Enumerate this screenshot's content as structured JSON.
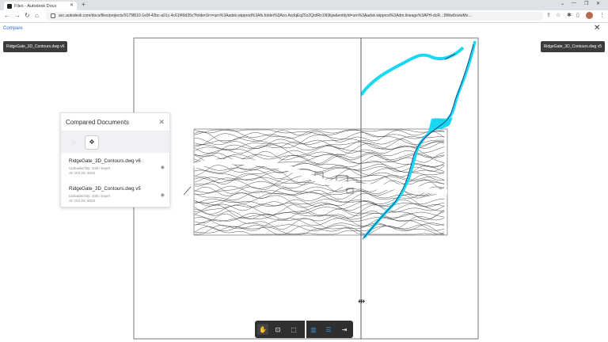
{
  "browser": {
    "tab_title": "Files - Autodesk Docs",
    "url": "acc.autodesk.com/docs/files/projects/9179f610-1e9f-42bc-a01c-4c61f49d35c?folderUrn=urn%3Aadsk.wipprod%3Afs.folder%3Aco.AcdqEqZ5z2QrdRn1N9kjw&entityId=urn%3Aadsk.wipprod%3Adm.lineage%3APH-dcR…8Ww8cwwMx…"
  },
  "app": {
    "title": "Compare"
  },
  "labels": {
    "left_doc": "RidgeGate_3D_Contours.dwg v6",
    "right_doc": "RidgeGate_3D_Contours.dwg v5"
  },
  "panel": {
    "title": "Compared Documents",
    "documents": [
      {
        "name": "RidgeGate_3D_Contours.dwg v6",
        "uploaded_by": "Uploaded By: John Sayre",
        "date": "At: Oct 24, 2022"
      },
      {
        "name": "RidgeGate_3D_Contours.dwg v5",
        "uploaded_by": "Uploaded By: John Sayre",
        "date": "At: Oct 24, 2022"
      }
    ]
  },
  "colors": {
    "toolbar_bg": "#2f2f2f",
    "accent": "#3a8fd6",
    "overlay_cyan": "#19d9f2",
    "line_dark": "#1a2a6c"
  }
}
